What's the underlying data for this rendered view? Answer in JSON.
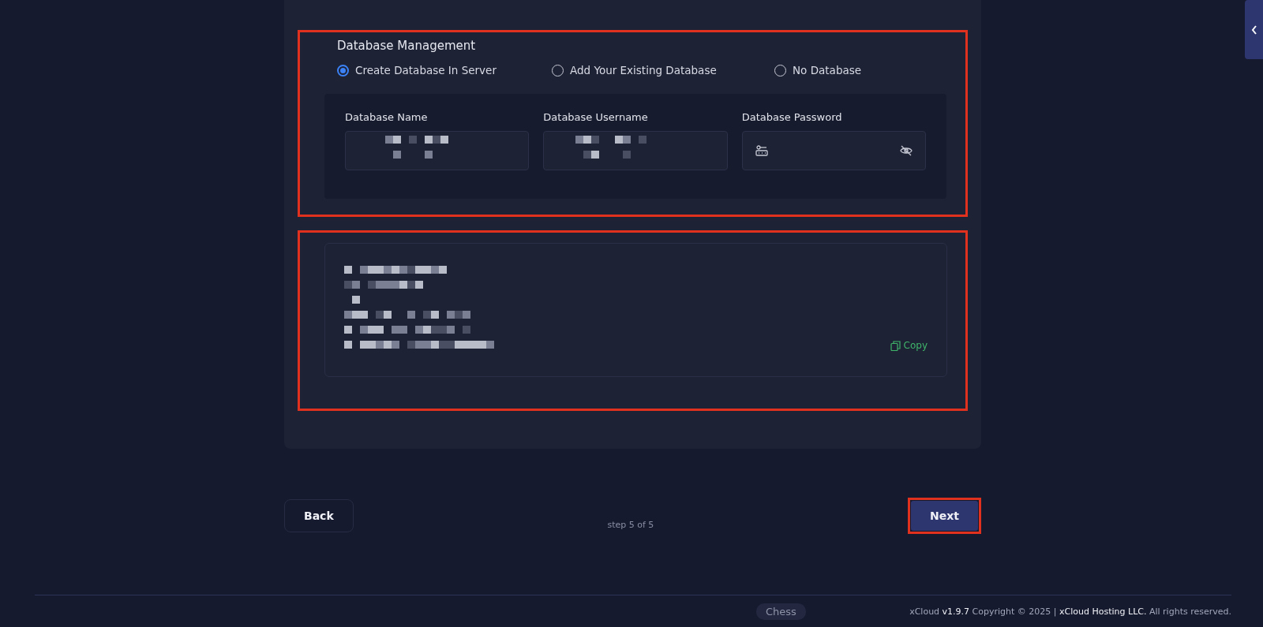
{
  "database": {
    "title": "Database Management",
    "options": [
      {
        "label": "Create Database In Server",
        "selected": true
      },
      {
        "label": "Add Your Existing Database",
        "selected": false
      },
      {
        "label": "No Database",
        "selected": false
      }
    ],
    "fields": [
      {
        "label": "Database Name",
        "kind": "text"
      },
      {
        "label": "Database Username",
        "kind": "text"
      },
      {
        "label": "Database Password",
        "kind": "password"
      }
    ]
  },
  "credentials": {
    "copy_label": "Copy"
  },
  "wizard": {
    "back": "Back",
    "step": "step 5 of 5",
    "next": "Next"
  },
  "footer": {
    "tooltip": "Chess",
    "text": "xCloud **v1.9.7**  Copyright © 2025 | **xCloud Hosting LLC.** All rights reserved."
  }
}
